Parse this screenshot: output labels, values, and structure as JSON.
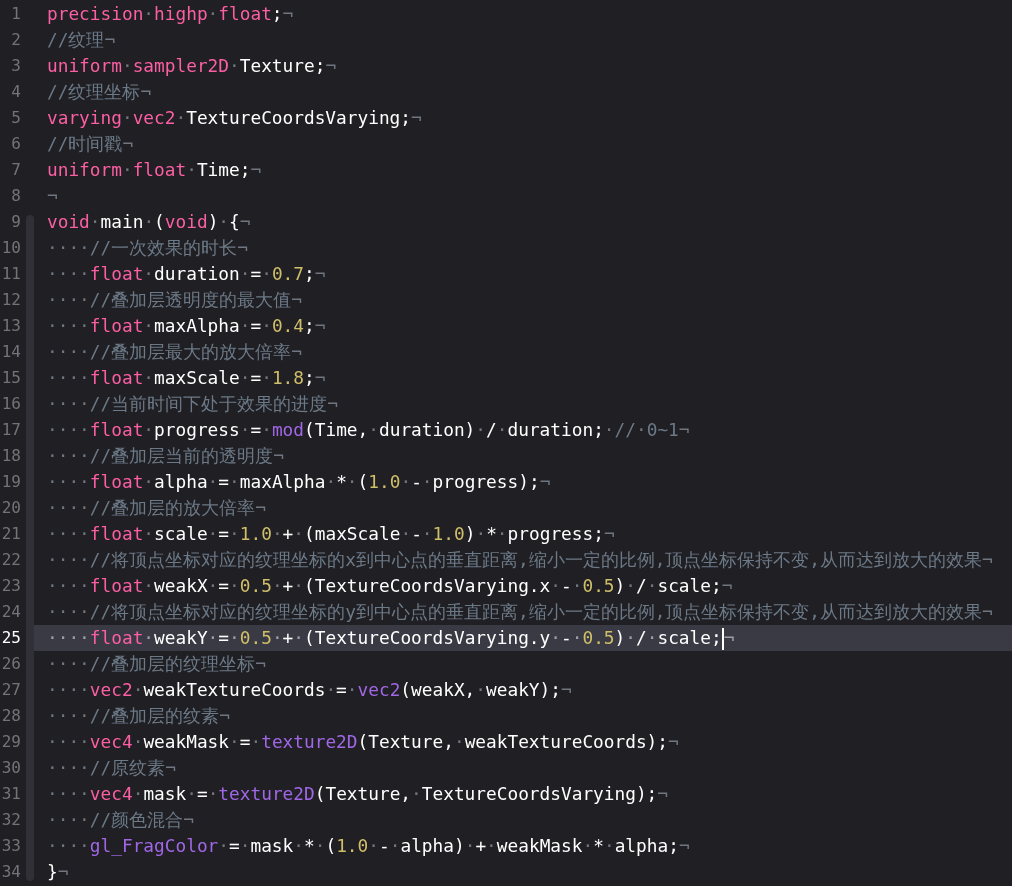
{
  "editor": {
    "lines": [
      {
        "number": "1",
        "in_scope": false,
        "current": false,
        "tokens": [
          {
            "kind": "kw",
            "text": "precision"
          },
          {
            "kind": "ws",
            "text": "·"
          },
          {
            "kind": "kw",
            "text": "highp"
          },
          {
            "kind": "ws",
            "text": "·"
          },
          {
            "kind": "kw",
            "text": "float"
          },
          {
            "kind": "plain",
            "text": ";"
          },
          {
            "kind": "ws",
            "text": "¬"
          }
        ]
      },
      {
        "number": "2",
        "in_scope": false,
        "current": false,
        "tokens": [
          {
            "kind": "comment",
            "text": "//纹理"
          },
          {
            "kind": "ws",
            "text": "¬"
          }
        ]
      },
      {
        "number": "3",
        "in_scope": false,
        "current": false,
        "tokens": [
          {
            "kind": "kw",
            "text": "uniform"
          },
          {
            "kind": "ws",
            "text": "·"
          },
          {
            "kind": "kw",
            "text": "sampler2D"
          },
          {
            "kind": "ws",
            "text": "·"
          },
          {
            "kind": "plain",
            "text": "Texture;"
          },
          {
            "kind": "ws",
            "text": "¬"
          }
        ]
      },
      {
        "number": "4",
        "in_scope": false,
        "current": false,
        "tokens": [
          {
            "kind": "comment",
            "text": "//纹理坐标"
          },
          {
            "kind": "ws",
            "text": "¬"
          }
        ]
      },
      {
        "number": "5",
        "in_scope": false,
        "current": false,
        "tokens": [
          {
            "kind": "kw",
            "text": "varying"
          },
          {
            "kind": "ws",
            "text": "·"
          },
          {
            "kind": "kw",
            "text": "vec2"
          },
          {
            "kind": "ws",
            "text": "·"
          },
          {
            "kind": "plain",
            "text": "TextureCoordsVarying;"
          },
          {
            "kind": "ws",
            "text": "¬"
          }
        ]
      },
      {
        "number": "6",
        "in_scope": false,
        "current": false,
        "tokens": [
          {
            "kind": "comment",
            "text": "//时间戳"
          },
          {
            "kind": "ws",
            "text": "¬"
          }
        ]
      },
      {
        "number": "7",
        "in_scope": false,
        "current": false,
        "tokens": [
          {
            "kind": "kw",
            "text": "uniform"
          },
          {
            "kind": "ws",
            "text": "·"
          },
          {
            "kind": "kw",
            "text": "float"
          },
          {
            "kind": "ws",
            "text": "·"
          },
          {
            "kind": "plain",
            "text": "Time;"
          },
          {
            "kind": "ws",
            "text": "¬"
          }
        ]
      },
      {
        "number": "8",
        "in_scope": false,
        "current": false,
        "tokens": [
          {
            "kind": "ws",
            "text": "¬"
          }
        ]
      },
      {
        "number": "9",
        "in_scope": true,
        "current": false,
        "tokens": [
          {
            "kind": "kw",
            "text": "void"
          },
          {
            "kind": "ws",
            "text": "·"
          },
          {
            "kind": "plain",
            "text": "main"
          },
          {
            "kind": "ws",
            "text": "·"
          },
          {
            "kind": "plain",
            "text": "("
          },
          {
            "kind": "kw",
            "text": "void"
          },
          {
            "kind": "plain",
            "text": ")"
          },
          {
            "kind": "ws",
            "text": "·"
          },
          {
            "kind": "plain",
            "text": "{"
          },
          {
            "kind": "ws",
            "text": "¬"
          }
        ]
      },
      {
        "number": "10",
        "in_scope": true,
        "current": false,
        "tokens": [
          {
            "kind": "ws",
            "text": "····"
          },
          {
            "kind": "comment",
            "text": "//一次效果的时长"
          },
          {
            "kind": "ws",
            "text": "¬"
          }
        ]
      },
      {
        "number": "11",
        "in_scope": true,
        "current": false,
        "tokens": [
          {
            "kind": "ws",
            "text": "····"
          },
          {
            "kind": "kw",
            "text": "float"
          },
          {
            "kind": "ws",
            "text": "·"
          },
          {
            "kind": "plain",
            "text": "duration"
          },
          {
            "kind": "ws",
            "text": "·"
          },
          {
            "kind": "plain",
            "text": "="
          },
          {
            "kind": "ws",
            "text": "·"
          },
          {
            "kind": "num",
            "text": "0.7"
          },
          {
            "kind": "plain",
            "text": ";"
          },
          {
            "kind": "ws",
            "text": "¬"
          }
        ]
      },
      {
        "number": "12",
        "in_scope": true,
        "current": false,
        "tokens": [
          {
            "kind": "ws",
            "text": "····"
          },
          {
            "kind": "comment",
            "text": "//叠加层透明度的最大值"
          },
          {
            "kind": "ws",
            "text": "¬"
          }
        ]
      },
      {
        "number": "13",
        "in_scope": true,
        "current": false,
        "tokens": [
          {
            "kind": "ws",
            "text": "····"
          },
          {
            "kind": "kw",
            "text": "float"
          },
          {
            "kind": "ws",
            "text": "·"
          },
          {
            "kind": "plain",
            "text": "maxAlpha"
          },
          {
            "kind": "ws",
            "text": "·"
          },
          {
            "kind": "plain",
            "text": "="
          },
          {
            "kind": "ws",
            "text": "·"
          },
          {
            "kind": "num",
            "text": "0.4"
          },
          {
            "kind": "plain",
            "text": ";"
          },
          {
            "kind": "ws",
            "text": "¬"
          }
        ]
      },
      {
        "number": "14",
        "in_scope": true,
        "current": false,
        "tokens": [
          {
            "kind": "ws",
            "text": "····"
          },
          {
            "kind": "comment",
            "text": "//叠加层最大的放大倍率"
          },
          {
            "kind": "ws",
            "text": "¬"
          }
        ]
      },
      {
        "number": "15",
        "in_scope": true,
        "current": false,
        "tokens": [
          {
            "kind": "ws",
            "text": "····"
          },
          {
            "kind": "kw",
            "text": "float"
          },
          {
            "kind": "ws",
            "text": "·"
          },
          {
            "kind": "plain",
            "text": "maxScale"
          },
          {
            "kind": "ws",
            "text": "·"
          },
          {
            "kind": "plain",
            "text": "="
          },
          {
            "kind": "ws",
            "text": "·"
          },
          {
            "kind": "num",
            "text": "1.8"
          },
          {
            "kind": "plain",
            "text": ";"
          },
          {
            "kind": "ws",
            "text": "¬"
          }
        ]
      },
      {
        "number": "16",
        "in_scope": true,
        "current": false,
        "tokens": [
          {
            "kind": "ws",
            "text": "····"
          },
          {
            "kind": "comment",
            "text": "//当前时间下处于效果的进度"
          },
          {
            "kind": "ws",
            "text": "¬"
          }
        ]
      },
      {
        "number": "17",
        "in_scope": true,
        "current": false,
        "tokens": [
          {
            "kind": "ws",
            "text": "····"
          },
          {
            "kind": "kw",
            "text": "float"
          },
          {
            "kind": "ws",
            "text": "·"
          },
          {
            "kind": "plain",
            "text": "progress"
          },
          {
            "kind": "ws",
            "text": "·"
          },
          {
            "kind": "plain",
            "text": "="
          },
          {
            "kind": "ws",
            "text": "·"
          },
          {
            "kind": "fn",
            "text": "mod"
          },
          {
            "kind": "plain",
            "text": "(Time,"
          },
          {
            "kind": "ws",
            "text": "·"
          },
          {
            "kind": "plain",
            "text": "duration)"
          },
          {
            "kind": "ws",
            "text": "·"
          },
          {
            "kind": "plain",
            "text": "/"
          },
          {
            "kind": "ws",
            "text": "·"
          },
          {
            "kind": "plain",
            "text": "duration;"
          },
          {
            "kind": "ws",
            "text": "·"
          },
          {
            "kind": "comment",
            "text": "//"
          },
          {
            "kind": "ws",
            "text": "·"
          },
          {
            "kind": "comment",
            "text": "0~1"
          },
          {
            "kind": "ws",
            "text": "¬"
          }
        ]
      },
      {
        "number": "18",
        "in_scope": true,
        "current": false,
        "tokens": [
          {
            "kind": "ws",
            "text": "····"
          },
          {
            "kind": "comment",
            "text": "//叠加层当前的透明度"
          },
          {
            "kind": "ws",
            "text": "¬"
          }
        ]
      },
      {
        "number": "19",
        "in_scope": true,
        "current": false,
        "tokens": [
          {
            "kind": "ws",
            "text": "····"
          },
          {
            "kind": "kw",
            "text": "float"
          },
          {
            "kind": "ws",
            "text": "·"
          },
          {
            "kind": "plain",
            "text": "alpha"
          },
          {
            "kind": "ws",
            "text": "·"
          },
          {
            "kind": "plain",
            "text": "="
          },
          {
            "kind": "ws",
            "text": "·"
          },
          {
            "kind": "plain",
            "text": "maxAlpha"
          },
          {
            "kind": "ws",
            "text": "·"
          },
          {
            "kind": "plain",
            "text": "*"
          },
          {
            "kind": "ws",
            "text": "·"
          },
          {
            "kind": "plain",
            "text": "("
          },
          {
            "kind": "num",
            "text": "1.0"
          },
          {
            "kind": "ws",
            "text": "·"
          },
          {
            "kind": "plain",
            "text": "-"
          },
          {
            "kind": "ws",
            "text": "·"
          },
          {
            "kind": "plain",
            "text": "progress);"
          },
          {
            "kind": "ws",
            "text": "¬"
          }
        ]
      },
      {
        "number": "20",
        "in_scope": true,
        "current": false,
        "tokens": [
          {
            "kind": "ws",
            "text": "····"
          },
          {
            "kind": "comment",
            "text": "//叠加层的放大倍率"
          },
          {
            "kind": "ws",
            "text": "¬"
          }
        ]
      },
      {
        "number": "21",
        "in_scope": true,
        "current": false,
        "tokens": [
          {
            "kind": "ws",
            "text": "····"
          },
          {
            "kind": "kw",
            "text": "float"
          },
          {
            "kind": "ws",
            "text": "·"
          },
          {
            "kind": "plain",
            "text": "scale"
          },
          {
            "kind": "ws",
            "text": "·"
          },
          {
            "kind": "plain",
            "text": "="
          },
          {
            "kind": "ws",
            "text": "·"
          },
          {
            "kind": "num",
            "text": "1.0"
          },
          {
            "kind": "ws",
            "text": "·"
          },
          {
            "kind": "plain",
            "text": "+"
          },
          {
            "kind": "ws",
            "text": "·"
          },
          {
            "kind": "plain",
            "text": "(maxScale"
          },
          {
            "kind": "ws",
            "text": "·"
          },
          {
            "kind": "plain",
            "text": "-"
          },
          {
            "kind": "ws",
            "text": "·"
          },
          {
            "kind": "num",
            "text": "1.0"
          },
          {
            "kind": "plain",
            "text": ")"
          },
          {
            "kind": "ws",
            "text": "·"
          },
          {
            "kind": "plain",
            "text": "*"
          },
          {
            "kind": "ws",
            "text": "·"
          },
          {
            "kind": "plain",
            "text": "progress;"
          },
          {
            "kind": "ws",
            "text": "¬"
          }
        ]
      },
      {
        "number": "22",
        "in_scope": true,
        "current": false,
        "tokens": [
          {
            "kind": "ws",
            "text": "····"
          },
          {
            "kind": "comment",
            "text": "//将顶点坐标对应的纹理坐标的x到中心点的垂直距离,缩小一定的比例,顶点坐标保持不变,从而达到放大的效果"
          },
          {
            "kind": "ws",
            "text": "¬"
          }
        ]
      },
      {
        "number": "23",
        "in_scope": true,
        "current": false,
        "tokens": [
          {
            "kind": "ws",
            "text": "····"
          },
          {
            "kind": "kw",
            "text": "float"
          },
          {
            "kind": "ws",
            "text": "·"
          },
          {
            "kind": "plain",
            "text": "weakX"
          },
          {
            "kind": "ws",
            "text": "·"
          },
          {
            "kind": "plain",
            "text": "="
          },
          {
            "kind": "ws",
            "text": "·"
          },
          {
            "kind": "num",
            "text": "0.5"
          },
          {
            "kind": "ws",
            "text": "·"
          },
          {
            "kind": "plain",
            "text": "+"
          },
          {
            "kind": "ws",
            "text": "·"
          },
          {
            "kind": "plain",
            "text": "(TextureCoordsVarying.x"
          },
          {
            "kind": "ws",
            "text": "·"
          },
          {
            "kind": "plain",
            "text": "-"
          },
          {
            "kind": "ws",
            "text": "·"
          },
          {
            "kind": "num",
            "text": "0.5"
          },
          {
            "kind": "plain",
            "text": ")"
          },
          {
            "kind": "ws",
            "text": "·"
          },
          {
            "kind": "plain",
            "text": "/"
          },
          {
            "kind": "ws",
            "text": "·"
          },
          {
            "kind": "plain",
            "text": "scale;"
          },
          {
            "kind": "ws",
            "text": "¬"
          }
        ]
      },
      {
        "number": "24",
        "in_scope": true,
        "current": false,
        "tokens": [
          {
            "kind": "ws",
            "text": "····"
          },
          {
            "kind": "comment",
            "text": "//将顶点坐标对应的纹理坐标的y到中心点的垂直距离,缩小一定的比例,顶点坐标保持不变,从而达到放大的效果"
          },
          {
            "kind": "ws",
            "text": "¬"
          }
        ]
      },
      {
        "number": "25",
        "in_scope": true,
        "current": true,
        "tokens": [
          {
            "kind": "ws",
            "text": "····"
          },
          {
            "kind": "kw",
            "text": "float"
          },
          {
            "kind": "ws",
            "text": "·"
          },
          {
            "kind": "plain",
            "text": "weakY"
          },
          {
            "kind": "ws",
            "text": "·"
          },
          {
            "kind": "plain",
            "text": "="
          },
          {
            "kind": "ws",
            "text": "·"
          },
          {
            "kind": "num",
            "text": "0.5"
          },
          {
            "kind": "ws",
            "text": "·"
          },
          {
            "kind": "plain",
            "text": "+"
          },
          {
            "kind": "ws",
            "text": "·"
          },
          {
            "kind": "plain",
            "text": "(TextureCoordsVarying.y"
          },
          {
            "kind": "ws",
            "text": "·"
          },
          {
            "kind": "plain",
            "text": "-"
          },
          {
            "kind": "ws",
            "text": "·"
          },
          {
            "kind": "num",
            "text": "0.5"
          },
          {
            "kind": "plain",
            "text": ")"
          },
          {
            "kind": "ws",
            "text": "·"
          },
          {
            "kind": "plain",
            "text": "/"
          },
          {
            "kind": "ws",
            "text": "·"
          },
          {
            "kind": "plain",
            "text": "scale;"
          },
          {
            "kind": "cursor",
            "text": "¬"
          }
        ]
      },
      {
        "number": "26",
        "in_scope": true,
        "current": false,
        "tokens": [
          {
            "kind": "ws",
            "text": "····"
          },
          {
            "kind": "comment",
            "text": "//叠加层的纹理坐标"
          },
          {
            "kind": "ws",
            "text": "¬"
          }
        ]
      },
      {
        "number": "27",
        "in_scope": true,
        "current": false,
        "tokens": [
          {
            "kind": "ws",
            "text": "····"
          },
          {
            "kind": "kw",
            "text": "vec2"
          },
          {
            "kind": "ws",
            "text": "·"
          },
          {
            "kind": "plain",
            "text": "weakTextureCoords"
          },
          {
            "kind": "ws",
            "text": "·"
          },
          {
            "kind": "plain",
            "text": "="
          },
          {
            "kind": "ws",
            "text": "·"
          },
          {
            "kind": "fn",
            "text": "vec2"
          },
          {
            "kind": "plain",
            "text": "(weakX,"
          },
          {
            "kind": "ws",
            "text": "·"
          },
          {
            "kind": "plain",
            "text": "weakY);"
          },
          {
            "kind": "ws",
            "text": "¬"
          }
        ]
      },
      {
        "number": "28",
        "in_scope": true,
        "current": false,
        "tokens": [
          {
            "kind": "ws",
            "text": "····"
          },
          {
            "kind": "comment",
            "text": "//叠加层的纹素"
          },
          {
            "kind": "ws",
            "text": "¬"
          }
        ]
      },
      {
        "number": "29",
        "in_scope": true,
        "current": false,
        "tokens": [
          {
            "kind": "ws",
            "text": "····"
          },
          {
            "kind": "kw",
            "text": "vec4"
          },
          {
            "kind": "ws",
            "text": "·"
          },
          {
            "kind": "plain",
            "text": "weakMask"
          },
          {
            "kind": "ws",
            "text": "·"
          },
          {
            "kind": "plain",
            "text": "="
          },
          {
            "kind": "ws",
            "text": "·"
          },
          {
            "kind": "fn",
            "text": "texture2D"
          },
          {
            "kind": "plain",
            "text": "(Texture,"
          },
          {
            "kind": "ws",
            "text": "·"
          },
          {
            "kind": "plain",
            "text": "weakTextureCoords);"
          },
          {
            "kind": "ws",
            "text": "¬"
          }
        ]
      },
      {
        "number": "30",
        "in_scope": true,
        "current": false,
        "tokens": [
          {
            "kind": "ws",
            "text": "····"
          },
          {
            "kind": "comment",
            "text": "//原纹素"
          },
          {
            "kind": "ws",
            "text": "¬"
          }
        ]
      },
      {
        "number": "31",
        "in_scope": true,
        "current": false,
        "tokens": [
          {
            "kind": "ws",
            "text": "····"
          },
          {
            "kind": "kw",
            "text": "vec4"
          },
          {
            "kind": "ws",
            "text": "·"
          },
          {
            "kind": "plain",
            "text": "mask"
          },
          {
            "kind": "ws",
            "text": "·"
          },
          {
            "kind": "plain",
            "text": "="
          },
          {
            "kind": "ws",
            "text": "·"
          },
          {
            "kind": "fn",
            "text": "texture2D"
          },
          {
            "kind": "plain",
            "text": "(Texture,"
          },
          {
            "kind": "ws",
            "text": "·"
          },
          {
            "kind": "plain",
            "text": "TextureCoordsVarying);"
          },
          {
            "kind": "ws",
            "text": "¬"
          }
        ]
      },
      {
        "number": "32",
        "in_scope": true,
        "current": false,
        "tokens": [
          {
            "kind": "ws",
            "text": "····"
          },
          {
            "kind": "comment",
            "text": "//颜色混合"
          },
          {
            "kind": "ws",
            "text": "¬"
          }
        ]
      },
      {
        "number": "33",
        "in_scope": true,
        "current": false,
        "tokens": [
          {
            "kind": "ws",
            "text": "····"
          },
          {
            "kind": "fn",
            "text": "gl_FragColor"
          },
          {
            "kind": "ws",
            "text": "·"
          },
          {
            "kind": "plain",
            "text": "="
          },
          {
            "kind": "ws",
            "text": "·"
          },
          {
            "kind": "plain",
            "text": "mask"
          },
          {
            "kind": "ws",
            "text": "·"
          },
          {
            "kind": "plain",
            "text": "*"
          },
          {
            "kind": "ws",
            "text": "·"
          },
          {
            "kind": "plain",
            "text": "("
          },
          {
            "kind": "num",
            "text": "1.0"
          },
          {
            "kind": "ws",
            "text": "·"
          },
          {
            "kind": "plain",
            "text": "-"
          },
          {
            "kind": "ws",
            "text": "·"
          },
          {
            "kind": "plain",
            "text": "alpha)"
          },
          {
            "kind": "ws",
            "text": "·"
          },
          {
            "kind": "plain",
            "text": "+"
          },
          {
            "kind": "ws",
            "text": "·"
          },
          {
            "kind": "plain",
            "text": "weakMask"
          },
          {
            "kind": "ws",
            "text": "·"
          },
          {
            "kind": "plain",
            "text": "*"
          },
          {
            "kind": "ws",
            "text": "·"
          },
          {
            "kind": "plain",
            "text": "alpha;"
          },
          {
            "kind": "ws",
            "text": "¬"
          }
        ]
      },
      {
        "number": "34",
        "in_scope": true,
        "current": false,
        "tokens": [
          {
            "kind": "plain",
            "text": "}"
          },
          {
            "kind": "ws",
            "text": "¬"
          }
        ]
      }
    ]
  }
}
